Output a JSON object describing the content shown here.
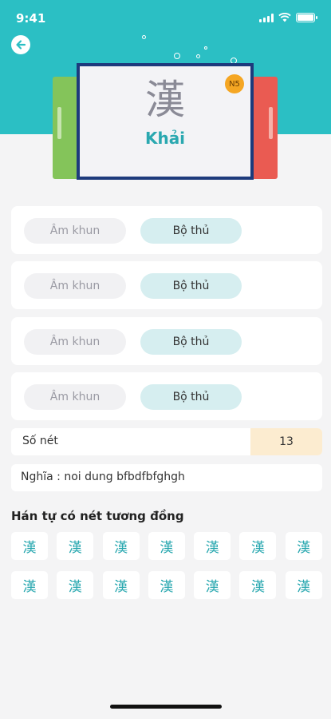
{
  "status_bar": {
    "time": "9:41"
  },
  "card": {
    "kanji": "漢",
    "reading": "Khải",
    "level": "N5"
  },
  "rows": [
    {
      "on_reading": "Âm khun",
      "radical": "Bộ thủ"
    },
    {
      "on_reading": "Âm khun",
      "radical": "Bộ thủ"
    },
    {
      "on_reading": "Âm khun",
      "radical": "Bộ thủ"
    },
    {
      "on_reading": "Âm khun",
      "radical": "Bộ thủ"
    }
  ],
  "strokes": {
    "label": "Số nét",
    "value": "13"
  },
  "meaning": {
    "text": "Nghĩa : noi dung bfbdfbfghgh"
  },
  "similar": {
    "title": "Hán tự có nét tương đồng",
    "items": [
      "漢",
      "漢",
      "漢",
      "漢",
      "漢",
      "漢",
      "漢",
      "漢",
      "漢",
      "漢",
      "漢",
      "漢",
      "漢",
      "漢"
    ]
  },
  "colors": {
    "header": "#2bbfc4",
    "accent_text": "#2aa8b0",
    "card_border": "#1d3a7c",
    "badge": "#f5a623"
  }
}
